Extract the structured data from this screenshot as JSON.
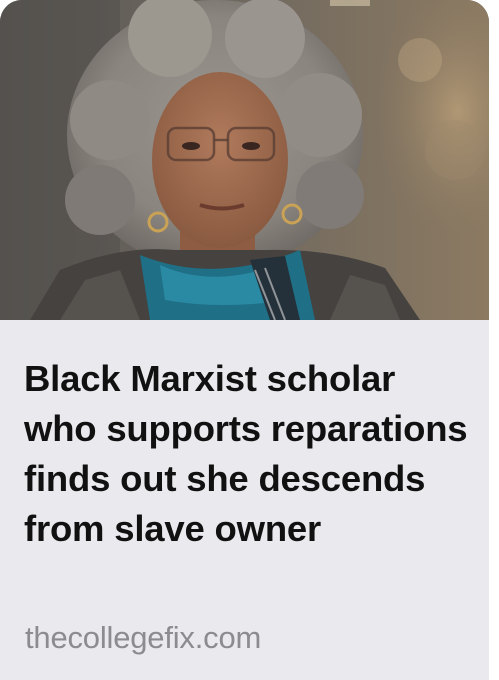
{
  "article": {
    "headline": "Black Marxist scholar who supports reparations finds out she descends from slave owner",
    "source": "thecollegefix.com",
    "thumbnail_icon": "portrait-photo"
  }
}
